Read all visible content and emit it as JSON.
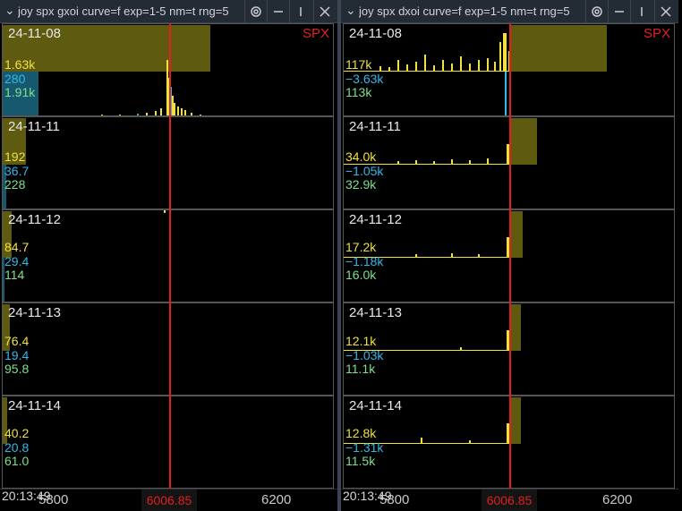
{
  "window_left": {
    "title": "joy spx gxoi curve=f exp=1-5 nm=t rng=5"
  },
  "window_right": {
    "title": "joy spx dxoi curve=f exp=1-5 nm=t rng=5"
  },
  "symbol": "SPX",
  "price": "6006.85",
  "footer": {
    "time": "20:13:49",
    "tick_left": "5800",
    "tick_right": "6200"
  },
  "panels_left": [
    {
      "date": "24-11-08",
      "v1": "1.63k",
      "v2": "280",
      "v3": "1.91k"
    },
    {
      "date": "24-11-11",
      "v1": "192",
      "v2": "36.7",
      "v3": "228"
    },
    {
      "date": "24-11-12",
      "v1": "84.7",
      "v2": "29.4",
      "v3": "114"
    },
    {
      "date": "24-11-13",
      "v1": "76.4",
      "v2": "19.4",
      "v3": "95.8"
    },
    {
      "date": "24-11-14",
      "v1": "40.2",
      "v2": "20.8",
      "v3": "61.0"
    }
  ],
  "panels_right": [
    {
      "date": "24-11-08",
      "v1": "117k",
      "v2": "−3.63k",
      "v3": "113k"
    },
    {
      "date": "24-11-11",
      "v1": "34.0k",
      "v2": "−1.05k",
      "v3": "32.9k"
    },
    {
      "date": "24-11-12",
      "v1": "17.2k",
      "v2": "−1.18k",
      "v3": "16.0k"
    },
    {
      "date": "24-11-13",
      "v1": "12.1k",
      "v2": "−1.03k",
      "v3": "11.1k"
    },
    {
      "date": "24-11-14",
      "v1": "12.8k",
      "v2": "−1.31k",
      "v3": "11.5k"
    }
  ],
  "colors": {
    "positive": "#f0e23a",
    "negative": "#30b8e8",
    "net": "#7ee08a",
    "cumulative_fill": "#5e5a10",
    "price_line": "#e02020"
  },
  "icons": [
    "chevron-down-icon",
    "gear-icon",
    "minimize-icon",
    "maximize-icon",
    "close-icon"
  ]
}
